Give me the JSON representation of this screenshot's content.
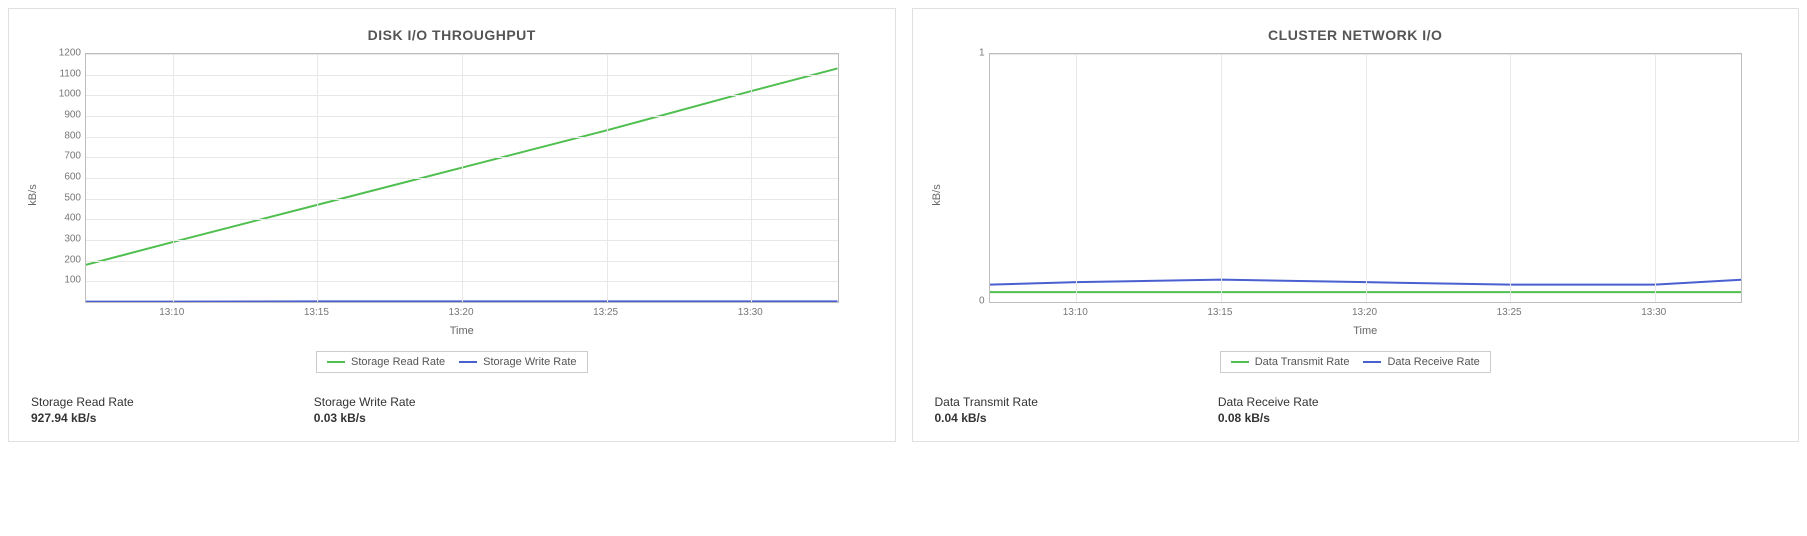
{
  "colors": {
    "green": "#4fbf4f",
    "blue": "#4a5fd0"
  },
  "chart_data": [
    {
      "type": "line",
      "title": "DISK I/O THROUGHPUT",
      "xlabel": "Time",
      "ylabel": "kB/s",
      "x": [
        "13:07",
        "13:10",
        "13:15",
        "13:20",
        "13:25",
        "13:30",
        "13:33"
      ],
      "x_ticks": [
        "13:10",
        "13:15",
        "13:20",
        "13:25",
        "13:30"
      ],
      "ylim": [
        0,
        1200
      ],
      "y_ticks": [
        100,
        200,
        300,
        400,
        500,
        600,
        700,
        800,
        900,
        1000,
        1100,
        1200
      ],
      "grid": true,
      "series": [
        {
          "name": "Storage Read Rate",
          "color": "green",
          "values": [
            180,
            290,
            470,
            650,
            830,
            1020,
            1130
          ]
        },
        {
          "name": "Storage Write Rate",
          "color": "blue",
          "values": [
            2,
            2,
            3,
            3,
            3,
            3,
            3
          ]
        }
      ],
      "legend": [
        "Storage Read Rate",
        "Storage Write Rate"
      ],
      "stats": [
        {
          "label": "Storage Read Rate",
          "value": "927.94 kB/s"
        },
        {
          "label": "Storage Write Rate",
          "value": "0.03 kB/s"
        }
      ]
    },
    {
      "type": "line",
      "title": "CLUSTER NETWORK I/O",
      "xlabel": "Time",
      "ylabel": "kB/s",
      "x": [
        "13:07",
        "13:10",
        "13:15",
        "13:20",
        "13:25",
        "13:30",
        "13:33"
      ],
      "x_ticks": [
        "13:10",
        "13:15",
        "13:20",
        "13:25",
        "13:30"
      ],
      "ylim": [
        0,
        1
      ],
      "y_ticks": [
        0,
        1
      ],
      "grid": true,
      "series": [
        {
          "name": "Data Transmit Rate",
          "color": "green",
          "values": [
            0.04,
            0.04,
            0.04,
            0.04,
            0.04,
            0.04,
            0.04
          ]
        },
        {
          "name": "Data Receive Rate",
          "color": "blue",
          "values": [
            0.07,
            0.08,
            0.09,
            0.08,
            0.07,
            0.07,
            0.09
          ]
        }
      ],
      "legend": [
        "Data Transmit Rate",
        "Data Receive Rate"
      ],
      "stats": [
        {
          "label": "Data Transmit Rate",
          "value": "0.04 kB/s"
        },
        {
          "label": "Data Receive Rate",
          "value": "0.08 kB/s"
        }
      ]
    }
  ]
}
